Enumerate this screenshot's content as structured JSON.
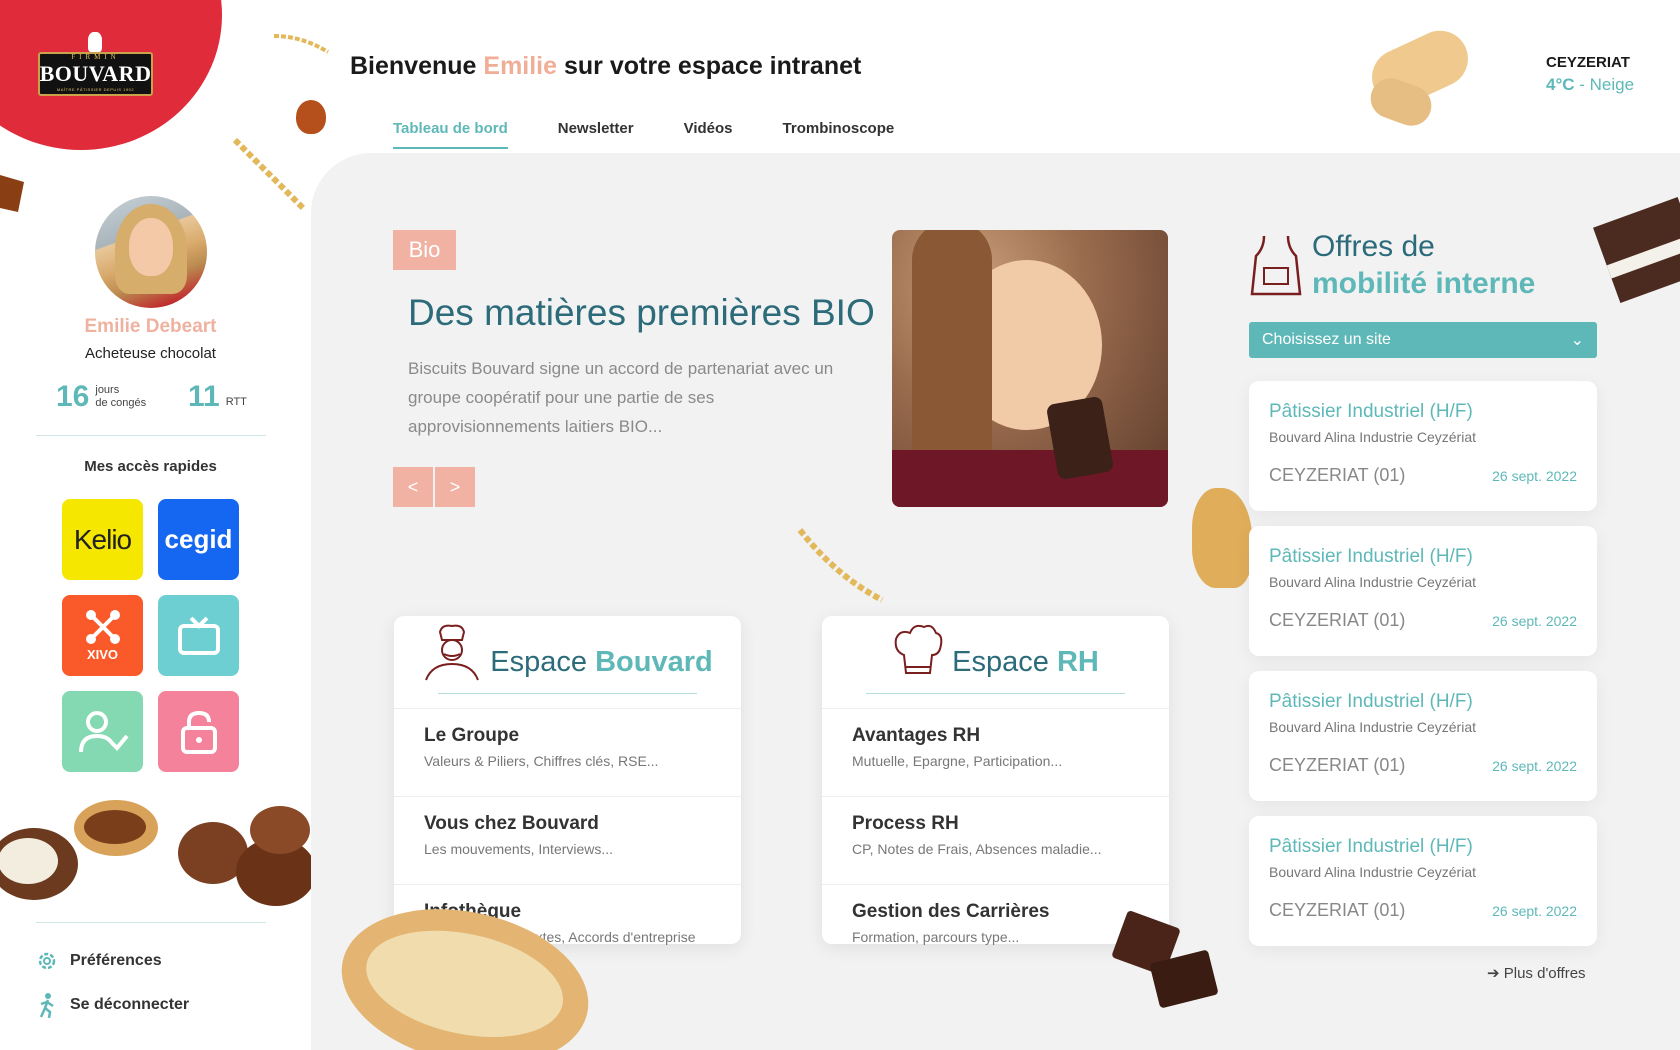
{
  "brand": {
    "top": "FIRMIN",
    "name": "BOUVARD",
    "tagline": "MAÎTRE PÂTISSIER DEPUIS 1902"
  },
  "header": {
    "welcome_pre": "Bienvenue",
    "user_first": "Emilie",
    "welcome_post": "sur votre espace intranet",
    "tabs": [
      "Tableau de bord",
      "Newsletter",
      "Vidéos",
      "Trombinoscope"
    ]
  },
  "weather": {
    "city": "CEYZERIAT",
    "temp": "4°C",
    "sep": " - ",
    "cond": "Neige"
  },
  "profile": {
    "name": "Emilie Debeart",
    "role": "Acheteuse chocolat",
    "leave_days": "16",
    "leave_label_1": "jours",
    "leave_label_2": "de congés",
    "rtt": "11",
    "rtt_label": "RTT"
  },
  "quick_access": {
    "title": "Mes accès rapides",
    "tiles": [
      "Kelio",
      "cegid",
      "XIVO"
    ]
  },
  "footer": {
    "prefs": "Préférences",
    "logout": "Se déconnecter"
  },
  "news": {
    "badge": "Bio",
    "title": "Des matières premières BIO",
    "text": "Biscuits Bouvard signe un accord de partenariat avec un groupe coopératif pour une partie de ses approvisionnements laitiers BIO...",
    "prev": "<",
    "next": ">"
  },
  "espace_bouvard": {
    "title_pre": "Espace",
    "title_bold": "Bouvard",
    "items": [
      {
        "t": "Le Groupe",
        "s": "Valeurs & Piliers, Chiffres clés, RSE..."
      },
      {
        "t": "Vous chez Bouvard",
        "s": "Les mouvements, Interviews..."
      },
      {
        "t": "Infothèque",
        "s": "Livret d'accueil, textes, Accords d'entreprise"
      }
    ]
  },
  "espace_rh": {
    "title_pre": "Espace",
    "title_bold": "RH",
    "items": [
      {
        "t": "Avantages RH",
        "s": "Mutuelle, Epargne, Participation..."
      },
      {
        "t": "Process RH",
        "s": "CP, Notes de Frais, Absences maladie..."
      },
      {
        "t": "Gestion des Carrières",
        "s": "Formation, parcours type..."
      }
    ]
  },
  "jobs": {
    "title_1": "Offres de",
    "title_2": "mobilité interne",
    "select": "Choisissez un site",
    "items": [
      {
        "title": "Pâtissier Industriel (H/F)",
        "company": "Bouvard Alina Industrie Ceyzériat",
        "loc": "CEYZERIAT (01)",
        "date": "26 sept. 2022"
      },
      {
        "title": "Pâtissier Industriel (H/F)",
        "company": "Bouvard Alina Industrie Ceyzériat",
        "loc": "CEYZERIAT (01)",
        "date": "26 sept. 2022"
      },
      {
        "title": "Pâtissier Industriel (H/F)",
        "company": "Bouvard Alina Industrie Ceyzériat",
        "loc": "CEYZERIAT (01)",
        "date": "26 sept. 2022"
      },
      {
        "title": "Pâtissier Industriel (H/F)",
        "company": "Bouvard Alina Industrie Ceyzériat",
        "loc": "CEYZERIAT (01)",
        "date": "26 sept. 2022"
      }
    ],
    "more": "Plus d'offres"
  },
  "colors": {
    "accent": "#5fb8b8",
    "salmon": "#f1b2a3",
    "brand_red": "#e02b3b",
    "dark_teal": "#2c6b7a"
  }
}
